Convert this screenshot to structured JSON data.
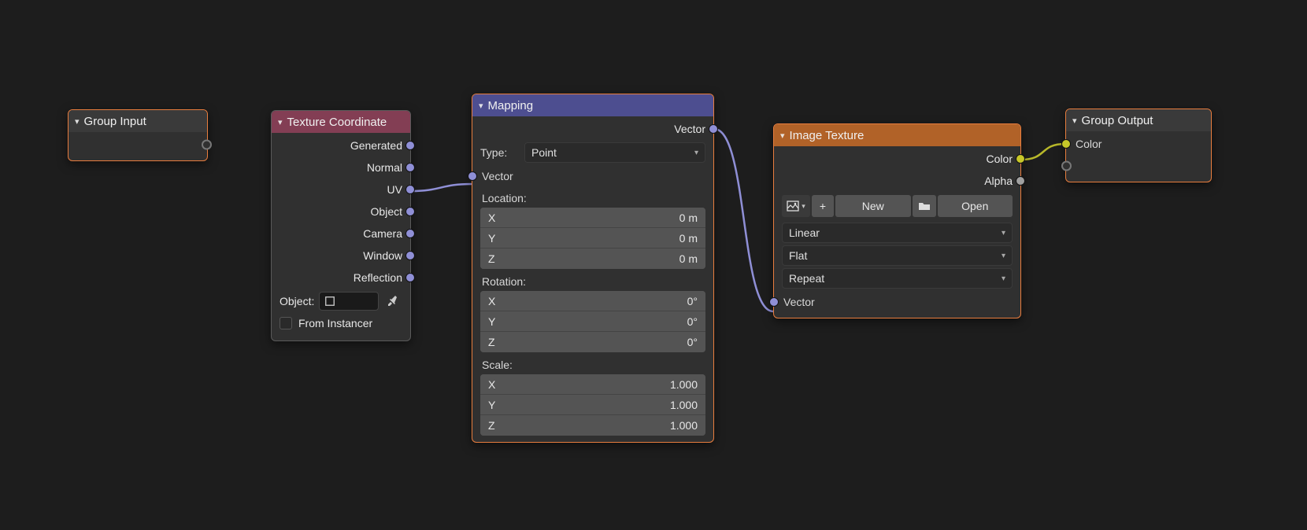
{
  "groupInput": {
    "title": "Group Input"
  },
  "texCoord": {
    "title": "Texture Coordinate",
    "outputs": [
      "Generated",
      "Normal",
      "UV",
      "Object",
      "Camera",
      "Window",
      "Reflection"
    ],
    "objectLabel": "Object:",
    "fromInstancer": "From Instancer"
  },
  "mapping": {
    "title": "Mapping",
    "vectorOut": "Vector",
    "typeLabel": "Type:",
    "typeValue": "Point",
    "vectorIn": "Vector",
    "locationLabel": "Location:",
    "location": {
      "X": "0 m",
      "Y": "0 m",
      "Z": "0 m"
    },
    "rotationLabel": "Rotation:",
    "rotation": {
      "X": "0°",
      "Y": "0°",
      "Z": "0°"
    },
    "scaleLabel": "Scale:",
    "scale": {
      "X": "1.000",
      "Y": "1.000",
      "Z": "1.000"
    }
  },
  "imageTex": {
    "title": "Image Texture",
    "colorOut": "Color",
    "alphaOut": "Alpha",
    "newLabel": "New",
    "openLabel": "Open",
    "interp": "Linear",
    "projection": "Flat",
    "extension": "Repeat",
    "vectorIn": "Vector"
  },
  "groupOutput": {
    "title": "Group Output",
    "colorIn": "Color"
  },
  "axes": {
    "x": "X",
    "y": "Y",
    "z": "Z"
  },
  "plus": "+"
}
